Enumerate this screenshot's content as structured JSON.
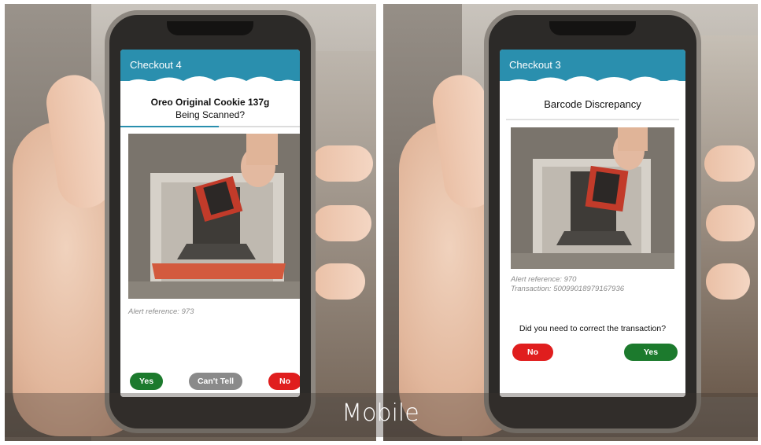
{
  "caption": "Mobile",
  "colors": {
    "header": "#2a8fae",
    "yes_green": "#1c7a2d",
    "no_red": "#e01e1e",
    "cant_tell_gray": "#8a8a8a"
  },
  "left_screen": {
    "header_title": "Checkout 4",
    "product_line": "Oreo Original Cookie 137g",
    "question_line": "Being Scanned?",
    "progress": 0.55,
    "alert_reference": "Alert reference: 973",
    "buttons": {
      "yes": "Yes",
      "cant_tell": "Can't Tell",
      "no": "No"
    }
  },
  "right_screen": {
    "header_title": "Checkout 3",
    "title": "Barcode Discrepancy",
    "alert_reference": "Alert reference: 970",
    "transaction": "Transaction: 50099018979167936",
    "question": "Did you need to correct the transaction?",
    "buttons": {
      "no": "No",
      "yes": "Yes"
    }
  }
}
